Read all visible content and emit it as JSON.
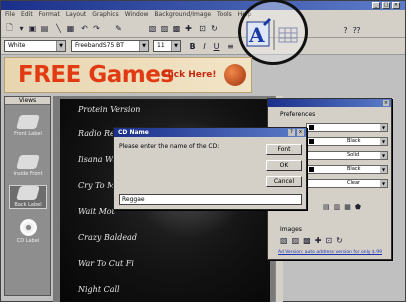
{
  "menu": [
    "File",
    "Edit",
    "Format",
    "Layout",
    "Graphics",
    "Window",
    "Background/Image",
    "Tools",
    "Help"
  ],
  "toolbar": {
    "style_value": "White",
    "font_value": "FreebandS75 BT",
    "size_value": "11"
  },
  "banner": {
    "headline": "FREE Games",
    "cta": "Click Here!"
  },
  "views": {
    "title": "Views",
    "items": [
      {
        "label": "Front Label"
      },
      {
        "label": "Inside Front"
      },
      {
        "label": "Back Label"
      },
      {
        "label": "CD Label"
      }
    ]
  },
  "cd_label": {
    "tracks": [
      "Protein Version",
      "Radio Reel",
      "Iisana Wa",
      "Cry To Me",
      "Wait Mot",
      "Crazy Baldead",
      "War To Cut Fi",
      "Night Call"
    ]
  },
  "preferences": {
    "title": "Preferences",
    "rows": [
      {
        "swatch_color": "#000000",
        "text": "Black"
      },
      {
        "swatch_color": "#000000",
        "text": "Black"
      },
      {
        "swatch_color": "#ffffff",
        "text": "Solid"
      },
      {
        "swatch_color": "#000000",
        "text": "Black"
      },
      {
        "swatch_color": "#ffffff",
        "text": "Clear"
      }
    ],
    "images_label": "Images",
    "ad_link": "Ad Version: auto address version for only $.99"
  },
  "dialog": {
    "title": "CD Name",
    "help_glyph": "?",
    "close_glyph": "x",
    "prompt": "Please enter the name of the CD:",
    "buttons": {
      "font": "Font",
      "ok": "OK",
      "cancel": "Cancel"
    },
    "input_value": "Reggae"
  },
  "colors": {
    "banner_text": "#e23a12",
    "title_bar": "#1a2f8a",
    "link": "#1a32b4"
  }
}
